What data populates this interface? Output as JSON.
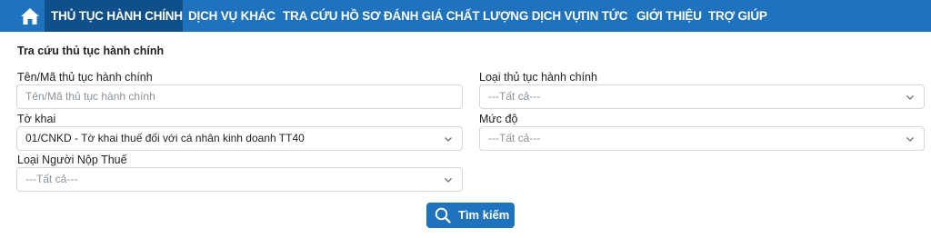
{
  "nav": {
    "home_icon": "home-icon",
    "items": [
      {
        "label": "THỦ TỤC HÀNH CHÍNH",
        "active": true
      },
      {
        "label": "DỊCH VỤ KHÁC",
        "active": false
      },
      {
        "label": "TRA CỨU HỒ SƠ",
        "active": false
      },
      {
        "label": "ĐÁNH GIÁ CHẤT LƯỢNG DỊCH VỤ",
        "active": false
      },
      {
        "label": "TIN TỨC",
        "active": false
      },
      {
        "label": "GIỚI THIỆU",
        "active": false
      },
      {
        "label": "TRỢ GIÚP",
        "active": false
      }
    ],
    "colors": {
      "bar": "#1f73be",
      "active": "#0f4f8a"
    }
  },
  "form": {
    "title": "Tra cứu thủ tục hành chính",
    "procedure_name": {
      "label": "Tên/Mã thủ tục hành chính",
      "placeholder": "Tên/Mã thủ tục hành chính",
      "value": ""
    },
    "procedure_type": {
      "label": "Loại thủ tục hành chính",
      "selected": "---Tất cả---"
    },
    "declaration": {
      "label": "Tờ khai",
      "selected": "01/CNKD - Tờ khai thuế đối với cá nhân kinh doanh TT40"
    },
    "level": {
      "label": "Mức độ",
      "selected": "---Tất cả---"
    },
    "taxpayer_type": {
      "label": "Loại Người Nộp Thuế",
      "selected": "---Tất cả---"
    }
  },
  "search_button": {
    "label": "Tìm kiếm",
    "icon": "search-icon"
  }
}
